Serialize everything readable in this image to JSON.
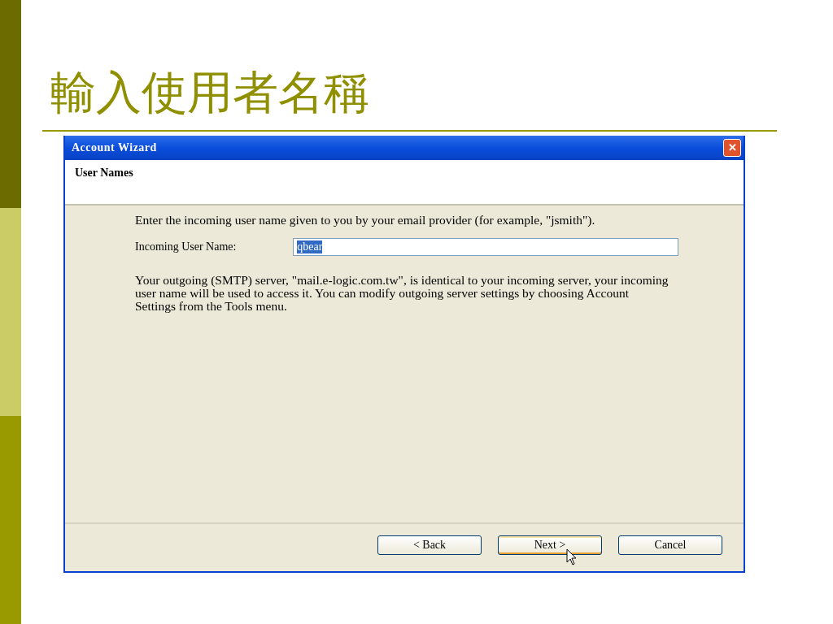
{
  "slide": {
    "title": "輸入使用者名稱"
  },
  "window": {
    "title": "Account Wizard",
    "close_button": "✕"
  },
  "header": {
    "title": "User Names"
  },
  "body": {
    "instruction": "Enter the incoming user name given to you by your email provider (for example, \"jsmith\").",
    "field": {
      "label": "Incoming User Name:",
      "value": "qbear",
      "selected": true
    },
    "note": "Your outgoing (SMTP) server, \"mail.e-logic.com.tw\", is identical to your incoming server, your incoming user name will be used to access it. You can modify outgoing server settings by choosing Account Settings from the Tools menu."
  },
  "buttons": [
    {
      "label": "< Back",
      "default": false
    },
    {
      "label": "Next >",
      "default": true
    },
    {
      "label": "Cancel",
      "default": false
    }
  ]
}
